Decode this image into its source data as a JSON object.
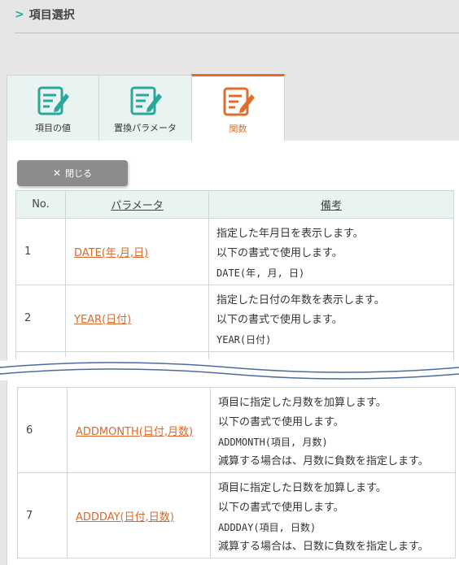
{
  "header": {
    "title": "項目選択"
  },
  "tabs": [
    {
      "label": "項目の値",
      "icon": "edit-icon",
      "active": false
    },
    {
      "label": "置換パラメータ",
      "icon": "edit-icon",
      "active": false
    },
    {
      "label": "関数",
      "icon": "edit-icon",
      "active": true
    }
  ],
  "close_button": {
    "label": "閉じる",
    "icon": "close-icon"
  },
  "table": {
    "headers": {
      "no": "No.",
      "param": "パラメータ",
      "note": "備考"
    },
    "rows": [
      {
        "no": "1",
        "name": "DATE(年,月,日)",
        "desc": [
          "指定した年月日を表示します。",
          "以下の書式で使用します。",
          "DATE(年, 月, 日)"
        ]
      },
      {
        "no": "2",
        "name": "YEAR(日付)",
        "desc": [
          "指定した日付の年数を表示します。",
          "以下の書式で使用します。",
          "YEAR(日付)"
        ]
      },
      {
        "no": "6",
        "name": "ADDMONTH(日付,月数)",
        "desc": [
          "項目に指定した月数を加算します。",
          "以下の書式で使用します。",
          "ADDMONTH(項目, 月数)",
          "減算する場合は、月数に負数を指定します。"
        ]
      },
      {
        "no": "7",
        "name": "ADDDAY(日付,日数)",
        "desc": [
          "項目に指定した日数を加算します。",
          "以下の書式で使用します。",
          "ADDDAY(項目, 日数)",
          "減算する場合は、日数に負数を指定します。"
        ]
      }
    ]
  },
  "colors": {
    "accent": "#e06d2e",
    "teal": "#2aa79a",
    "header_bg": "#e9f4f2",
    "link": "#d9692a"
  }
}
